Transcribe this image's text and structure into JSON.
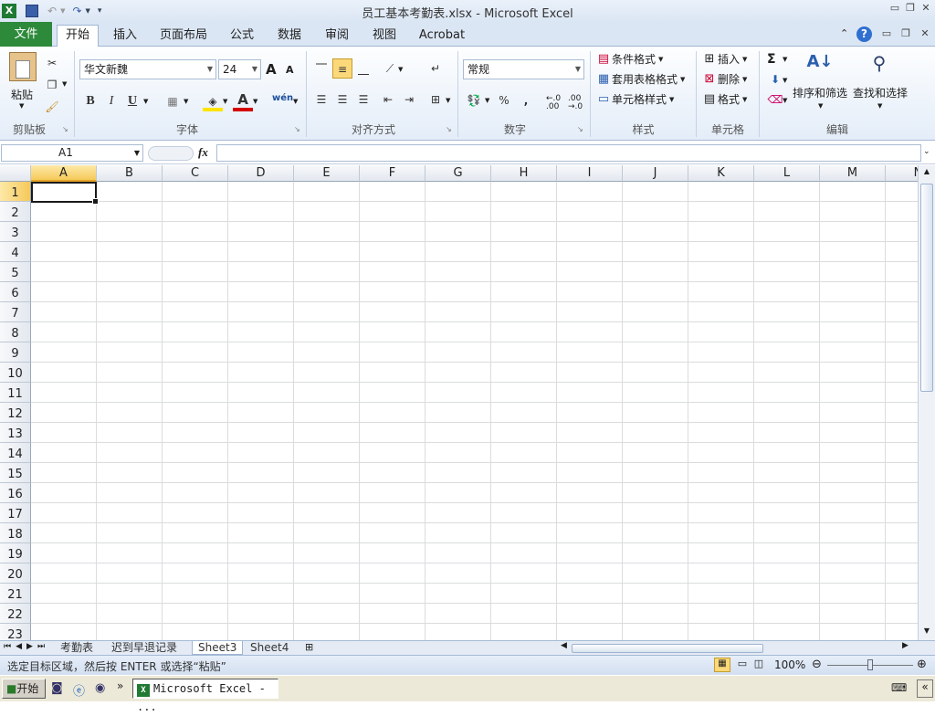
{
  "window": {
    "title": "员工基本考勤表.xlsx - Microsoft Excel"
  },
  "ribbon_tabs": {
    "file": "文件",
    "home": "开始",
    "insert": "插入",
    "page_layout": "页面布局",
    "formulas": "公式",
    "data": "数据",
    "review": "审阅",
    "view": "视图",
    "acrobat": "Acrobat"
  },
  "clipboard": {
    "paste": "粘贴",
    "group": "剪贴板"
  },
  "font": {
    "name": "华文新魏",
    "size": "24",
    "group": "字体",
    "grow": "A",
    "shrink": "A",
    "bold": "B",
    "italic": "I",
    "underline": "U",
    "font_color": "A",
    "phonetic": "wén"
  },
  "alignment": {
    "group": "对齐方式"
  },
  "number": {
    "format": "常规",
    "group": "数字",
    "percent": "%",
    "comma": ",",
    "inc_decimal": "←.0 .00",
    "dec_decimal": ".00 →.0"
  },
  "styles": {
    "conditional": "条件格式",
    "table": "套用表格格式",
    "cell": "单元格样式",
    "group": "样式"
  },
  "cells": {
    "insert": "插入",
    "delete": "删除",
    "format": "格式",
    "group": "单元格"
  },
  "editing": {
    "sigma": "Σ",
    "sort": "排序和筛选",
    "find": "查找和选择",
    "group": "编辑"
  },
  "formula_bar": {
    "name_box": "A1",
    "fx": "fx",
    "value": ""
  },
  "columns": [
    "A",
    "B",
    "C",
    "D",
    "E",
    "F",
    "G",
    "H",
    "I",
    "J",
    "K",
    "L",
    "M",
    "N"
  ],
  "rows": [
    "1",
    "2",
    "3",
    "4",
    "5",
    "6",
    "7",
    "8",
    "9",
    "10",
    "11",
    "12",
    "13",
    "14",
    "15",
    "16",
    "17",
    "18",
    "19",
    "20",
    "21",
    "22",
    "23"
  ],
  "sheets": [
    "考勤表",
    "迟到早退记录",
    "Sheet3",
    "Sheet4"
  ],
  "active_sheet": "Sheet3",
  "status": {
    "message": "选定目标区域，然后按 ENTER 或选择“粘贴”",
    "zoom": "100%"
  },
  "taskbar": {
    "start": "开始",
    "excel_task": "Microsoft Excel - ..."
  }
}
